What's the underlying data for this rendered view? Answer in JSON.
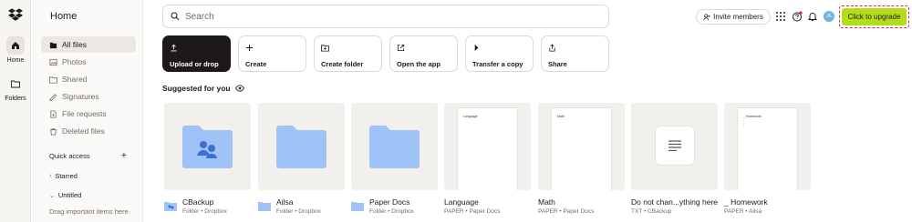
{
  "rail": {
    "items": [
      {
        "label": "Home",
        "icon": "home-icon"
      },
      {
        "label": "Folders",
        "icon": "folder-icon"
      }
    ]
  },
  "sidebar": {
    "title": "Home",
    "nav": [
      {
        "label": "All files",
        "icon": "all-files-icon"
      },
      {
        "label": "Photos",
        "icon": "photos-icon"
      },
      {
        "label": "Shared",
        "icon": "shared-icon"
      },
      {
        "label": "Signatures",
        "icon": "signature-icon"
      },
      {
        "label": "File requests",
        "icon": "file-request-icon"
      },
      {
        "label": "Deleted files",
        "icon": "trash-icon"
      }
    ],
    "quick_access": "Quick access",
    "starred": "Starred",
    "untitled": "Untitled",
    "drag_hint": "Drag important items here"
  },
  "search": {
    "placeholder": "Search"
  },
  "header": {
    "invite_label": "Invite members",
    "avatar_initials": "JE",
    "upgrade_label": "Click to upgrade"
  },
  "actions": [
    {
      "label": "Upload or drop",
      "icon": "upload-icon"
    },
    {
      "label": "Create",
      "icon": "plus-icon"
    },
    {
      "label": "Create folder",
      "icon": "new-folder-icon"
    },
    {
      "label": "Open the app",
      "icon": "open-external-icon"
    },
    {
      "label": "Transfer a copy",
      "icon": "transfer-icon"
    },
    {
      "label": "Share",
      "icon": "share-icon"
    }
  ],
  "suggested": {
    "title": "Suggested for you",
    "items": [
      {
        "name": "CBackup",
        "sub": "Folder • Dropbox",
        "kind": "shared-folder"
      },
      {
        "name": "Ailsa",
        "sub": "Folder • Dropbox",
        "kind": "folder"
      },
      {
        "name": "Paper Docs",
        "sub": "Folder • Dropbox",
        "kind": "folder"
      },
      {
        "name": "Language",
        "sub": "PAPER • Paper Docs",
        "kind": "paper",
        "doc_title": "Language"
      },
      {
        "name": "Math",
        "sub": "PAPER • Paper Docs",
        "kind": "paper",
        "doc_title": "Math"
      },
      {
        "name": "Do not chan...ything here",
        "sub": "TXT • CBackup",
        "kind": "txt"
      },
      {
        "name": "_ Homework",
        "sub": "PAPER • Ailsa",
        "kind": "paper",
        "doc_title": "_ Homework"
      }
    ]
  },
  "colors": {
    "accent_upgrade": "#b4dc19",
    "folder_blue": "#9fc3f7",
    "highlight_dashed": "#d9253a",
    "primary_dark": "#1e1919"
  }
}
